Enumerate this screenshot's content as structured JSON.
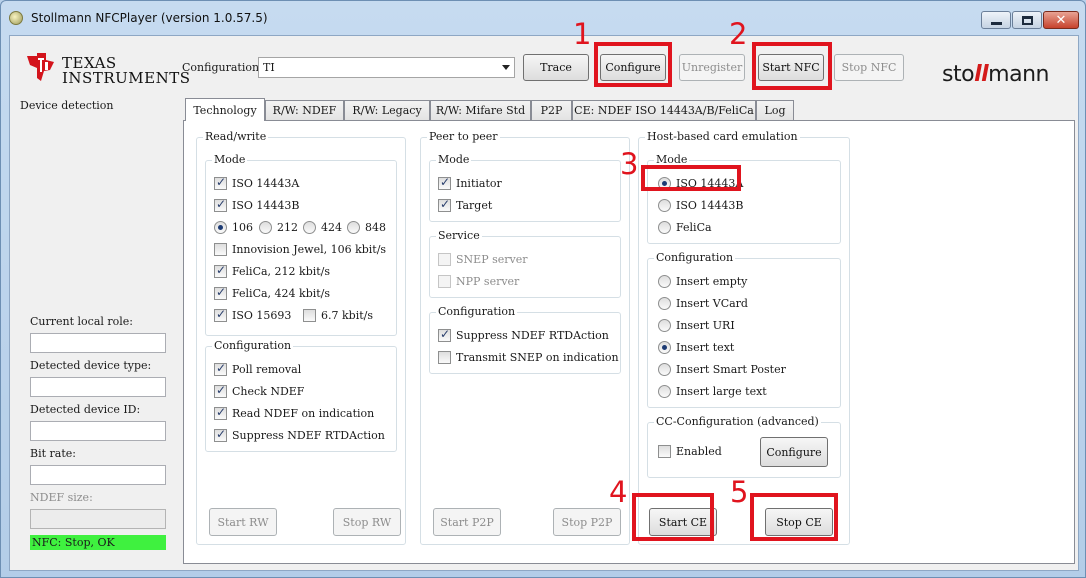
{
  "window": {
    "title": "Stollmann NFCPlayer (version 1.0.57.5)",
    "close_glyph": "✕"
  },
  "header": {
    "ti_logo_line1": "Texas",
    "ti_logo_line2": "Instruments",
    "configuration_label": "Configuration:",
    "configuration_value": "TI",
    "trace_label": "Trace",
    "configure_label": "Configure",
    "unregister_label": "Unregister",
    "start_nfc_label": "Start NFC",
    "stop_nfc_label": "Stop NFC",
    "stollmann_prefix": "sto",
    "stollmann_mark": "ll",
    "stollmann_suffix": "mann"
  },
  "annotations": {
    "n1": "1",
    "n2": "2",
    "n3": "3",
    "n4": "4",
    "n5": "5",
    "color": "#e0141e"
  },
  "left_panel": {
    "device_detection": "Device detection",
    "current_local_role": "Current local role:",
    "detected_device_type": "Detected device type:",
    "detected_device_id": "Detected device ID:",
    "bit_rate": "Bit rate:",
    "ndef_size": "NDEF size:",
    "status": "NFC: Stop, OK",
    "status_color": "#3ff13f"
  },
  "tabs": [
    {
      "label": "Technology"
    },
    {
      "label": "R/W: NDEF"
    },
    {
      "label": "R/W: Legacy"
    },
    {
      "label": "R/W: Mifare Std"
    },
    {
      "label": "P2P"
    },
    {
      "label": "CE: NDEF ISO 14443A/B/FeliCa"
    },
    {
      "label": "Log"
    }
  ],
  "read_write": {
    "title": "Read/write",
    "mode": {
      "title": "Mode",
      "iso14443a": "ISO 14443A",
      "iso14443b": "ISO 14443B",
      "rate_106": "106",
      "rate_212": "212",
      "rate_424": "424",
      "rate_848": "848",
      "innovision": "Innovision Jewel, 106 kbit/s",
      "felica212": "FeliCa, 212 kbit/s",
      "felica424": "FeliCa, 424 kbit/s",
      "iso15693": "ISO 15693",
      "rate_67": "6.7 kbit/s"
    },
    "configuration": {
      "title": "Configuration",
      "poll_removal": "Poll removal",
      "check_ndef": "Check NDEF",
      "read_ndef": "Read NDEF on indication",
      "suppress": "Suppress NDEF RTDAction"
    },
    "start_label": "Start RW",
    "stop_label": "Stop RW"
  },
  "p2p": {
    "title": "Peer to peer",
    "mode": {
      "title": "Mode",
      "initiator": "Initiator",
      "target": "Target"
    },
    "service": {
      "title": "Service",
      "snep": "SNEP server",
      "npp": "NPP server"
    },
    "configuration": {
      "title": "Configuration",
      "suppress": "Suppress NDEF RTDAction",
      "transmit": "Transmit SNEP on indication"
    },
    "start_label": "Start P2P",
    "stop_label": "Stop P2P"
  },
  "hce": {
    "title": "Host-based card emulation",
    "mode": {
      "title": "Mode",
      "iso14443a": "ISO 14443A",
      "iso14443b": "ISO 14443B",
      "felica": "FeliCa"
    },
    "configuration": {
      "title": "Configuration",
      "empty": "Insert empty",
      "vcard": "Insert VCard",
      "uri": "Insert URI",
      "text": "Insert text",
      "smart_poster": "Insert Smart Poster",
      "large_text": "Insert large text"
    },
    "cc": {
      "title": "CC-Configuration (advanced)",
      "enabled": "Enabled",
      "configure": "Configure"
    },
    "start_label": "Start CE",
    "stop_label": "Stop CE"
  }
}
